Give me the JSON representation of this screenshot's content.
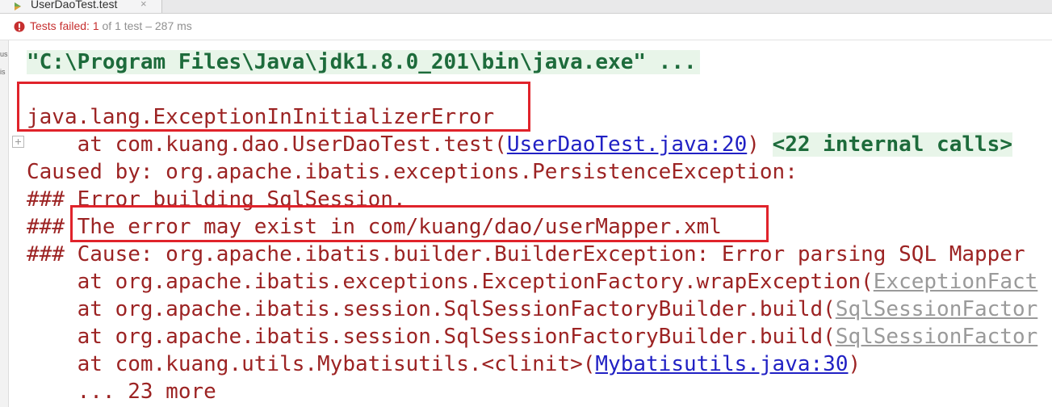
{
  "tab": {
    "title": "UserDaoTest.test",
    "close_glyph": "×"
  },
  "status": {
    "failed_label": "Tests failed: ",
    "failed_count": "1",
    "rest": " of 1 test – 287 ms"
  },
  "gutter": {
    "glyph_a": "us",
    "glyph_b": "is"
  },
  "console": {
    "command": "\"C:\\Program Files\\Java\\jdk1.8.0_201\\bin\\java.exe\" ...",
    "exception": "java.lang.ExceptionInInitializerError",
    "frame1_prefix": "    at com.kuang.dao.UserDaoTest.test(",
    "frame1_link": "UserDaoTest.java:20",
    "frame1_suffix": ") ",
    "frame1_internal": "<22 internal calls>",
    "caused_by": "Caused by: org.apache.ibatis.exceptions.PersistenceException:",
    "error_building": "### Error building SqlSession.",
    "may_exist_prefix": "### ",
    "may_exist": "The error may exist in com/kuang/dao/userMapper.xml",
    "cause": "### Cause: org.apache.ibatis.builder.BuilderException: Error parsing SQL Mapper",
    "frame2_prefix": "    at org.apache.ibatis.exceptions.ExceptionFactory.wrapException(",
    "frame2_link": "ExceptionFact",
    "frame3_prefix": "    at org.apache.ibatis.session.SqlSessionFactoryBuilder.build(",
    "frame3_link": "SqlSessionFactor",
    "frame4_prefix": "    at org.apache.ibatis.session.SqlSessionFactoryBuilder.build(",
    "frame4_link": "SqlSessionFactor",
    "frame5_prefix": "    at com.kuang.utils.Mybatisutils.<clinit>(",
    "frame5_link": "Mybatisutils.java:30",
    "frame5_suffix": ")",
    "more": "    ... 23 more"
  },
  "colors": {
    "error_text": "#9c2323",
    "highlight_box": "#e0232b",
    "link": "#2121c4",
    "command_green": "#1d6b3b"
  },
  "icons": [
    "tab-run-icon",
    "test-failed-icon",
    "expand-icon"
  ]
}
